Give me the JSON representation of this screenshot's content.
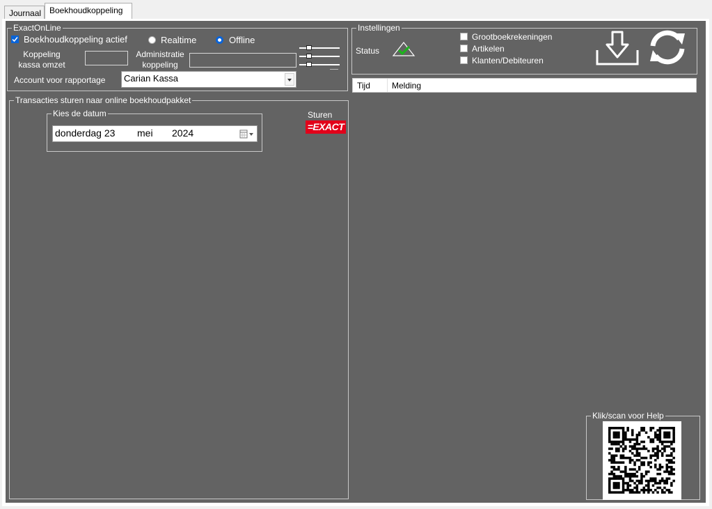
{
  "tabs": {
    "journaal": "Journaal",
    "boekhoud": "Boekhoudkoppeling"
  },
  "exact": {
    "legend": "ExactOnLine",
    "actief_label": "Boekhoudkoppeling actief",
    "actief_checked": true,
    "realtime_label": "Realtime",
    "offline_label": "Offline",
    "selected_mode": "Offline",
    "koppeling_line1": "Koppeling",
    "koppeling_line2": "kassa omzet",
    "koppeling_value": "",
    "administratie_line1": "Administratie",
    "administratie_line2": "koppeling",
    "administratie_value": "",
    "account_label": "Account voor rapportage",
    "account_value": "Carian Kassa"
  },
  "transacties": {
    "legend": "Transacties sturen  naar online boekhoudpakket",
    "date_legend": "Kies de datum",
    "date_day": "donderdag 23",
    "date_month": "mei",
    "date_year": "2024",
    "sturen_label": "Sturen",
    "exact_logo_text": "=EXACT"
  },
  "instellingen": {
    "legend": "Instellingen",
    "status_label": "Status",
    "options": [
      {
        "label": "Grootboekrekeningen",
        "checked": false
      },
      {
        "label": "Artikelen",
        "checked": false
      },
      {
        "label": "Klanten/Debiteuren",
        "checked": false
      }
    ]
  },
  "log": {
    "col_tijd": "Tijd",
    "col_melding": "Melding"
  },
  "help": {
    "legend": "Klik/scan voor Help"
  },
  "colors": {
    "panel": "#636363",
    "accent": "#0a64d8",
    "exact_red": "#e2001a",
    "status_green": "#1db31d"
  }
}
